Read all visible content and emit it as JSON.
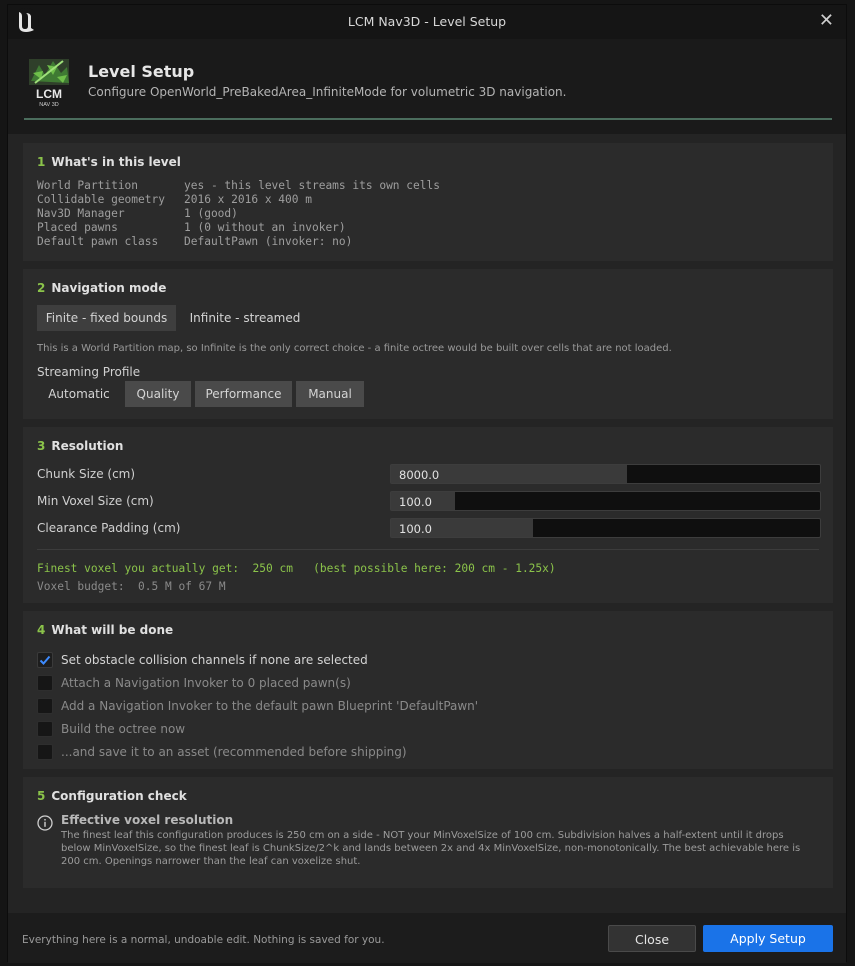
{
  "window": {
    "title": "LCM Nav3D - Level Setup"
  },
  "header": {
    "logo_top": "LCM",
    "logo_bottom": "NAV 3D",
    "title": "Level Setup",
    "subtitle": "Configure OpenWorld_PreBakedArea_InfiniteMode for volumetric 3D navigation."
  },
  "sections": {
    "level": {
      "num": "1",
      "title": "What's in this level",
      "rows": [
        {
          "k": "World Partition",
          "v": "yes - this level streams its own cells"
        },
        {
          "k": "Collidable geometry",
          "v": "2016 x 2016 x 400 m"
        },
        {
          "k": "Nav3D Manager",
          "v": "1 (good)"
        },
        {
          "k": "Placed pawns",
          "v": "1 (0 without an invoker)"
        },
        {
          "k": "Default pawn class",
          "v": "DefaultPawn (invoker: no)"
        }
      ]
    },
    "mode": {
      "num": "2",
      "title": "Navigation mode",
      "options": [
        "Finite - fixed bounds",
        "Infinite - streamed"
      ],
      "selected": "Finite - fixed bounds",
      "hint": "This is a World Partition map, so Infinite is the only correct choice - a finite octree would be built over cells that are not loaded.",
      "profile_label": "Streaming Profile",
      "profiles": [
        "Automatic",
        "Quality",
        "Performance",
        "Manual"
      ],
      "selected_profile": "Automatic"
    },
    "resolution": {
      "num": "3",
      "title": "Resolution",
      "fields": [
        {
          "label": "Chunk Size (cm)",
          "value": "8000.0",
          "fill": 0.55
        },
        {
          "label": "Min Voxel Size (cm)",
          "value": "100.0",
          "fill": 0.15
        },
        {
          "label": "Clearance Padding (cm)",
          "value": "100.0",
          "fill": 0.33
        }
      ],
      "finest_line": "Finest voxel you actually get:  250 cm   (best possible here: 200 cm - 1.25x)",
      "budget_line": "Voxel budget:  0.5 M of 67 M",
      "accent": "#8bc34a"
    },
    "actions": {
      "num": "4",
      "title": "What will be done",
      "items": [
        {
          "label": "Set obstacle collision channels if none are selected",
          "checked": true
        },
        {
          "label": "Attach a Navigation Invoker to 0 placed pawn(s)",
          "checked": false
        },
        {
          "label": "Add a Navigation Invoker to the default pawn Blueprint 'DefaultPawn'",
          "checked": false
        },
        {
          "label": "Build the octree now",
          "checked": false
        },
        {
          "label": "...and save it to an asset (recommended before shipping)",
          "checked": false
        }
      ]
    },
    "check": {
      "num": "5",
      "title": "Configuration check",
      "item_title": "Effective voxel resolution",
      "lines": [
        "The finest leaf this configuration produces is 250 cm on a side - NOT your MinVoxelSize of 100 cm. Subdivision halves a half-extent until it drops",
        "below MinVoxelSize, so the finest leaf is ChunkSize/2^k and lands between 2x and 4x MinVoxelSize, non-monotonically. The best achievable here is",
        "200 cm. Openings narrower than the leaf can voxelize shut."
      ]
    }
  },
  "footer": {
    "note": "Everything here is a normal, undoable edit. Nothing is saved for you.",
    "close_label": "Close",
    "apply_label": "Apply Setup",
    "apply_color": "#1a73e8"
  }
}
